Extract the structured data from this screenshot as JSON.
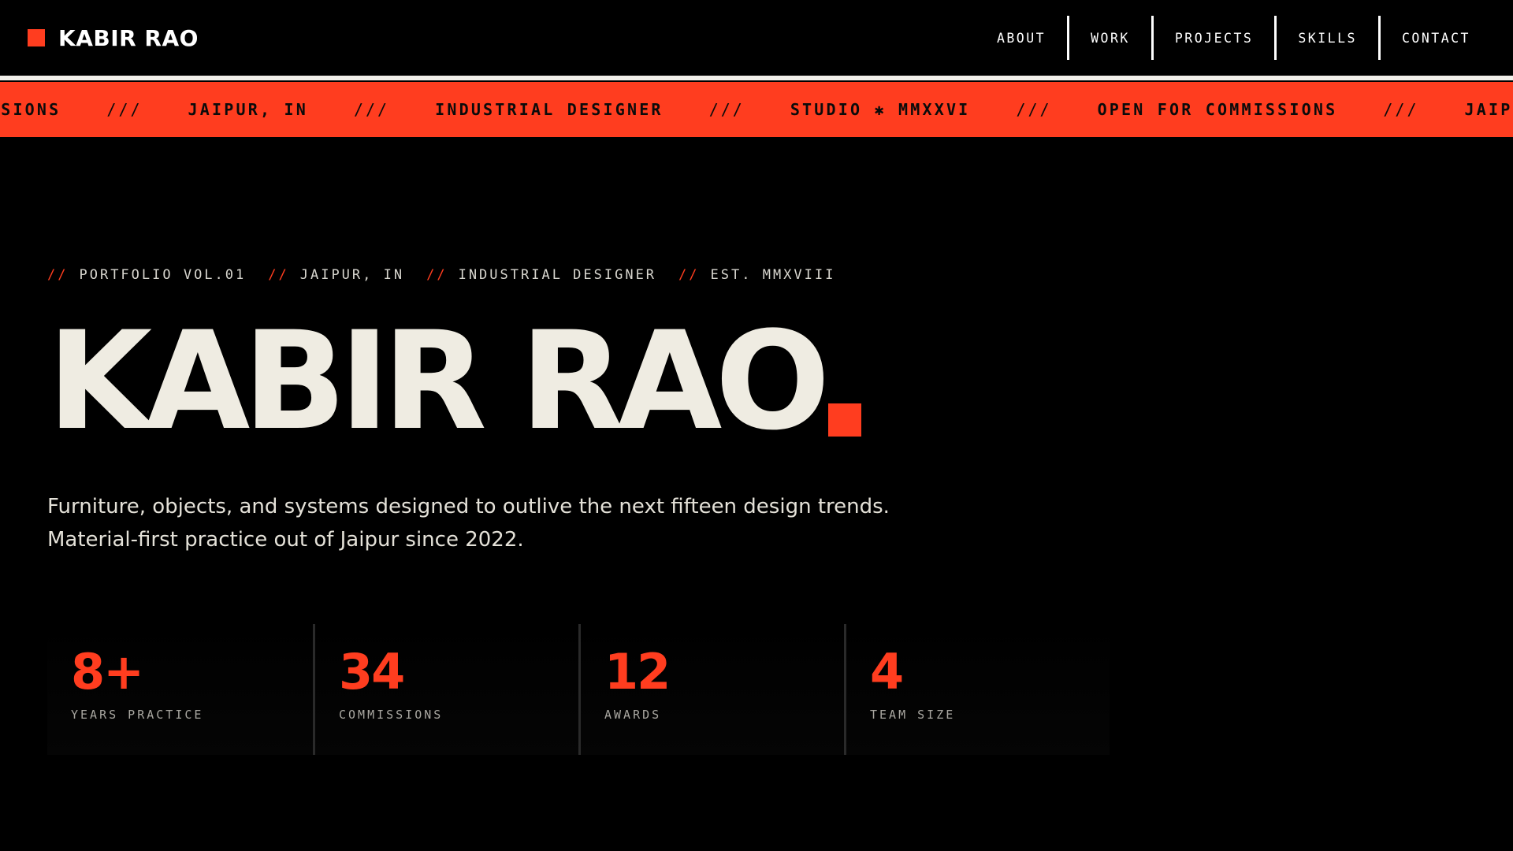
{
  "nav": {
    "brand": "KABIR RAO",
    "links": [
      "ABOUT",
      "WORK",
      "PROJECTS",
      "SKILLS",
      "CONTACT"
    ]
  },
  "ticker": {
    "items": [
      "OMMISSIONS",
      "JAIPUR, IN",
      "INDUSTRIAL DESIGNER",
      "STUDIO ✱ MMXXVI",
      "OPEN FOR COMMISSIONS",
      "JAIPUR, IN"
    ],
    "separator": "///"
  },
  "hero": {
    "meta": {
      "slash": "//",
      "items": [
        "PORTFOLIO VOL.01",
        "JAIPUR, IN",
        "INDUSTRIAL DESIGNER",
        "EST. MMXVIII"
      ]
    },
    "title": "KABIR RAO",
    "description": "Furniture, objects, and systems designed to outlive the next fifteen design trends. Material-first practice out of Jaipur since 2022."
  },
  "stats": [
    {
      "value": "8+",
      "label": "YEARS PRACTICE"
    },
    {
      "value": "34",
      "label": "COMMISSIONS"
    },
    {
      "value": "12",
      "label": "AWARDS"
    },
    {
      "value": "4",
      "label": "TEAM SIZE"
    }
  ],
  "colors": {
    "accent": "#ff3d1f",
    "background": "#000000",
    "text": "#efece2"
  }
}
